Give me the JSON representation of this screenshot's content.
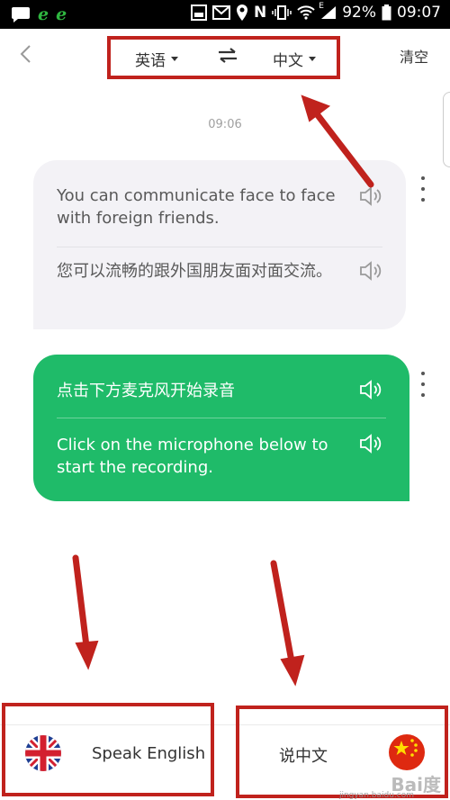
{
  "status_bar": {
    "battery": "92%",
    "time": "09:07",
    "network_label": "E"
  },
  "header": {
    "source_lang": "英语",
    "target_lang": "中文",
    "clear_label": "清空"
  },
  "conversation": {
    "timestamp": "09:06",
    "messages": [
      {
        "side": "left",
        "original": "You can communicate face to face with foreign friends.",
        "translation": "您可以流畅的跟外国朋友面对面交流。"
      },
      {
        "side": "right",
        "original": "点击下方麦克风开始录音",
        "translation": "Click on the microphone below to start the recording."
      }
    ]
  },
  "bottom": {
    "speak_english_label": "Speak English",
    "speak_chinese_label": "说中文"
  },
  "watermark": {
    "text": "Bai度",
    "sub": "jingyan.baidu.com"
  },
  "colors": {
    "accent_green": "#1fbb69",
    "annotation_red": "#c0221d",
    "bubble_gray": "#f3f2f6"
  }
}
